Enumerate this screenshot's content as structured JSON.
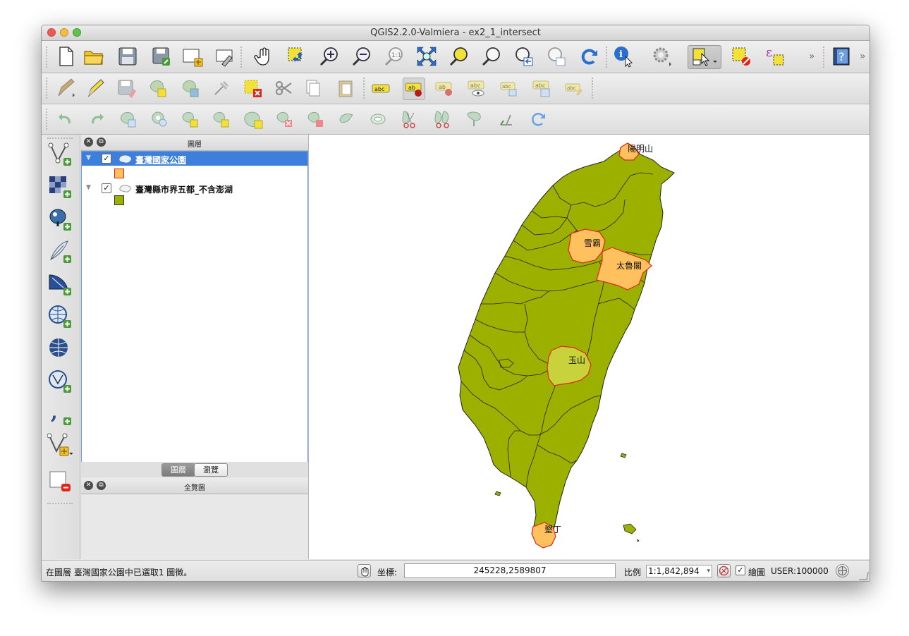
{
  "window": {
    "title": "QGIS2.2.0-Valmiera - ex2_1_intersect"
  },
  "layers_panel": {
    "title": "圖層",
    "layers": [
      {
        "name": "臺灣國家公園",
        "checked": true,
        "selected": true,
        "color": "#ffc15e"
      },
      {
        "name": "臺灣縣市界五都_不含澎湖",
        "checked": true,
        "selected": false,
        "color": "#9cb000"
      }
    ]
  },
  "panel_tabs": {
    "layers": "圖層",
    "browser": "瀏覽"
  },
  "overview_panel": {
    "title": "全覽圖"
  },
  "map": {
    "land_color": "#9cb000",
    "park_color": "#ffc15e",
    "park_border_color": "#e0261a",
    "labels": [
      "陽明山",
      "雪霸",
      "太魯閣",
      "玉山",
      "墾丁"
    ]
  },
  "statusbar": {
    "message": "在圖層 臺灣國家公園中已選取1 圖徵。",
    "coord_label": "坐標:",
    "coordinates": "245228,2589807",
    "scale_label": "比例",
    "scale_value": "1:1,842,894",
    "render_label": "繪圖",
    "crs": "USER:100000"
  },
  "toolbar_icons": [
    "new-project-icon",
    "open-project-icon",
    "save-project-icon",
    "save-as-icon",
    "new-print-composer-icon",
    "composer-manager-icon",
    "pan-icon",
    "pan-to-selection-icon",
    "zoom-in-icon",
    "zoom-out-icon",
    "zoom-actual-size-icon",
    "zoom-full-icon",
    "zoom-to-selection-icon",
    "zoom-to-layer-icon",
    "zoom-last-icon",
    "zoom-next-icon",
    "refresh-icon",
    "identify-icon",
    "run-action-icon",
    "select-features-icon",
    "deselect-icon",
    "expression-select-icon",
    "help-icon"
  ]
}
